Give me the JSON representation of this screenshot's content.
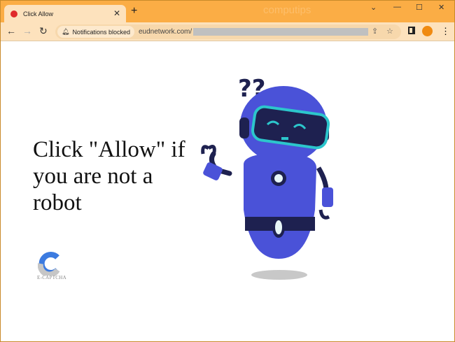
{
  "browser": {
    "tab_title": "Click Allow",
    "tab_close": "✕",
    "new_tab": "+",
    "watermark": "computips",
    "window_controls": {
      "dropdown": "⌄",
      "minimize": "—",
      "maximize": "☐",
      "close": "✕"
    },
    "nav": {
      "back": "←",
      "forward": "→",
      "reload": "↻"
    },
    "notification_chip": "Notifications blocked",
    "url": "eudnetwork.com/",
    "icons": {
      "share": "share-icon",
      "star": "☆",
      "sidepanel": "sidepanel-icon",
      "menu": "⋮"
    }
  },
  "page": {
    "headline": "Click \"Allow\" if you are not a robot",
    "logo_text": "E-CAPTCHA",
    "question_marks": "??",
    "colors": {
      "robot_body": "#4a52d8",
      "robot_dark": "#1e2150",
      "visor": "#2cc6cc",
      "accent": "#fbad45"
    }
  }
}
